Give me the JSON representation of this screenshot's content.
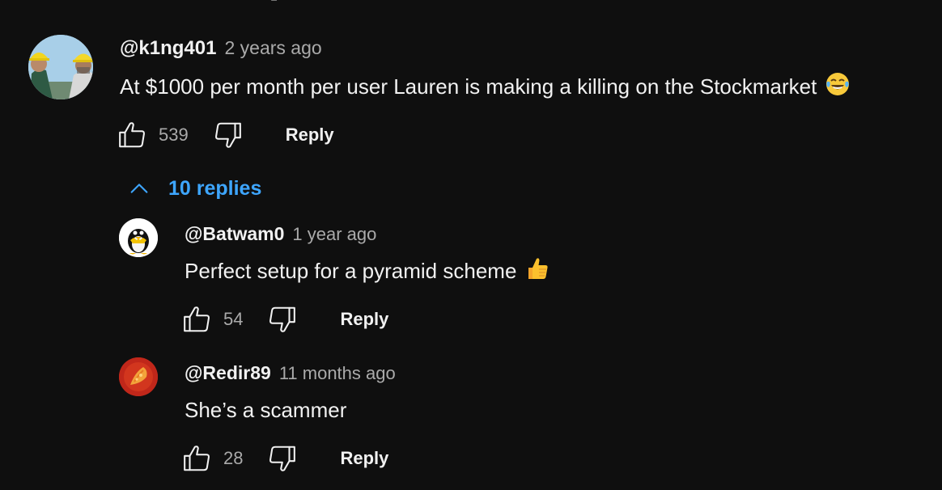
{
  "thread": {
    "author": "@k1ng401",
    "time": "2 years ago",
    "text": "At $1000 per month per user Lauren is making a killing on the Stockmarket",
    "emoji": "laughing-tears-emoji",
    "likes": "539",
    "reply_label": "Reply",
    "replies_toggle": "10 replies",
    "replies": [
      {
        "author": "@Batwam0",
        "time": "1 year ago",
        "text": "Perfect setup for a pyramid scheme",
        "emoji": "thumbs-up-emoji",
        "likes": "54",
        "reply_label": "Reply"
      },
      {
        "author": "@Redir89",
        "time": "11 months ago",
        "text": "She’s a scammer",
        "likes": "28",
        "reply_label": "Reply"
      }
    ]
  },
  "colors": {
    "background": "#0f0f0f",
    "text": "#f1f1f1",
    "secondary_text": "#aaaaaa",
    "link_blue": "#3ea6ff"
  },
  "icons": [
    "like-icon",
    "dislike-icon",
    "chevron-up-icon"
  ]
}
